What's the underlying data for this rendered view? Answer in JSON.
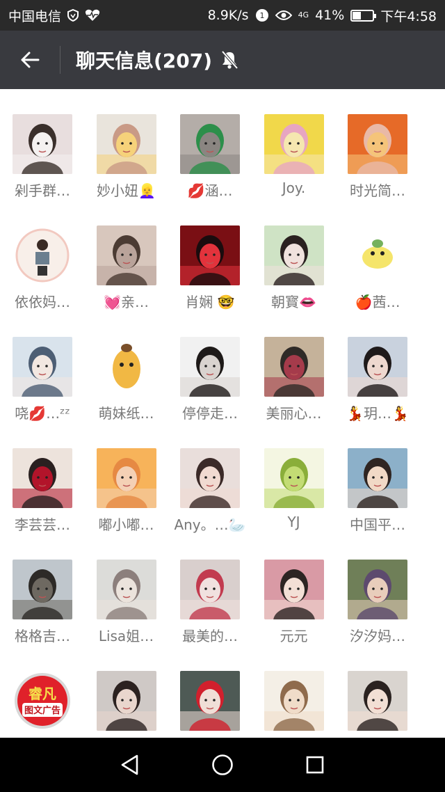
{
  "status_bar": {
    "carrier": "中国电信",
    "speed": "8.9K/s",
    "network": "4G",
    "battery_text": "41%",
    "battery_level": 0.41,
    "time": "下午4:58"
  },
  "header": {
    "title": "聊天信息(207)",
    "back_icon": "back-arrow-icon",
    "mute_icon": "bell-muted-icon"
  },
  "members": [
    {
      "name": "剁手群…",
      "colors": [
        "#e8dede",
        "#f4f1f0",
        "#3a2f2b"
      ]
    },
    {
      "name": "妙小妞👱‍♀️",
      "colors": [
        "#e9e4dc",
        "#f6d27a",
        "#c99a86"
      ]
    },
    {
      "name": "💋涵…",
      "colors": [
        "#b4ada8",
        "#8a8581",
        "#2c8f4a"
      ]
    },
    {
      "name": "Joy.",
      "colors": [
        "#f1d84a",
        "#f5e7b0",
        "#e7a6c1"
      ]
    },
    {
      "name": "时光简…",
      "colors": [
        "#e66a28",
        "#f5c47a",
        "#e9b9a7"
      ]
    },
    {
      "name": "依依妈…",
      "colors": [
        "#ffffff",
        "#f2c9c0",
        "#6b7f8f"
      ]
    },
    {
      "name": "💓亲…",
      "colors": [
        "#d8c7bd",
        "#b9a39a",
        "#4b3b33"
      ]
    },
    {
      "name": "肖娴 🤓",
      "colors": [
        "#7a0f14",
        "#e2333c",
        "#1a0c0e"
      ]
    },
    {
      "name": "朝寳👄",
      "colors": [
        "#cfe3c5",
        "#f0e2dd",
        "#2a2120"
      ]
    },
    {
      "name": "🍎茜…",
      "colors": [
        "#ffffff",
        "#f5e56b",
        "#75b15c"
      ]
    },
    {
      "name": "哓💋…ᶻᶻ",
      "colors": [
        "#d9e3ec",
        "#f2e7e1",
        "#4d5e74"
      ]
    },
    {
      "name": "萌妹纸…",
      "colors": [
        "#ffffff",
        "#f1b844",
        "#7a4f2a"
      ]
    },
    {
      "name": "停停走…",
      "colors": [
        "#f1f1f1",
        "#d9d3cf",
        "#1e1a19"
      ]
    },
    {
      "name": "美丽心…",
      "colors": [
        "#c5b29a",
        "#a53b4b",
        "#2f2a27"
      ]
    },
    {
      "name": "💃玥…💃",
      "colors": [
        "#c9d2de",
        "#eed8cf",
        "#1f1a1a"
      ]
    },
    {
      "name": "李芸芸…",
      "colors": [
        "#ede3dc",
        "#b2142a",
        "#2a2020"
      ]
    },
    {
      "name": "嘟小嘟…",
      "colors": [
        "#f7b35a",
        "#f4d0b5",
        "#e68943"
      ]
    },
    {
      "name": "Any。…🦢",
      "colors": [
        "#e9dedb",
        "#f1dad1",
        "#3b2a28"
      ]
    },
    {
      "name": "YJ",
      "colors": [
        "#f4f6e2",
        "#c3dc74",
        "#8aae3a"
      ]
    },
    {
      "name": "中国平…",
      "colors": [
        "#8cb0c9",
        "#f1d9c6",
        "#2f2522"
      ]
    },
    {
      "name": "格格吉…",
      "colors": [
        "#bfc6cc",
        "#6e6961",
        "#2d2a27"
      ]
    },
    {
      "name": "Lisa姐…",
      "colors": [
        "#dcdcd9",
        "#ebe3dc",
        "#8c7f7c"
      ]
    },
    {
      "name": "最美的…",
      "colors": [
        "#d9cfcd",
        "#f1e1df",
        "#c23b4f"
      ]
    },
    {
      "name": "元元",
      "colors": [
        "#d99aa5",
        "#f3dfd6",
        "#2c2423"
      ]
    },
    {
      "name": "汐汐妈…",
      "colors": [
        "#6f7f58",
        "#e8cdbb",
        "#5d4a6e"
      ]
    },
    {
      "name": "睿凡图文广告",
      "colors": [
        "#ffffff",
        "#e0212a",
        "#ffffff"
      ]
    },
    {
      "name": "",
      "colors": [
        "#cfc9c6",
        "#e9d6cd",
        "#2c2220"
      ]
    },
    {
      "name": "",
      "colors": [
        "#4e5a55",
        "#f0dfd7",
        "#d1202d"
      ]
    },
    {
      "name": "",
      "colors": [
        "#f4efe6",
        "#f0dcc9",
        "#8f6b4c"
      ]
    },
    {
      "name": "",
      "colors": [
        "#d9d4cf",
        "#f2dfd4",
        "#2a2220"
      ]
    }
  ],
  "logo_text": {
    "line1": "睿凡",
    "line2": "图文广告"
  },
  "nav": {
    "back": "triangle-back-icon",
    "home": "circle-home-icon",
    "recents": "square-recents-icon"
  }
}
